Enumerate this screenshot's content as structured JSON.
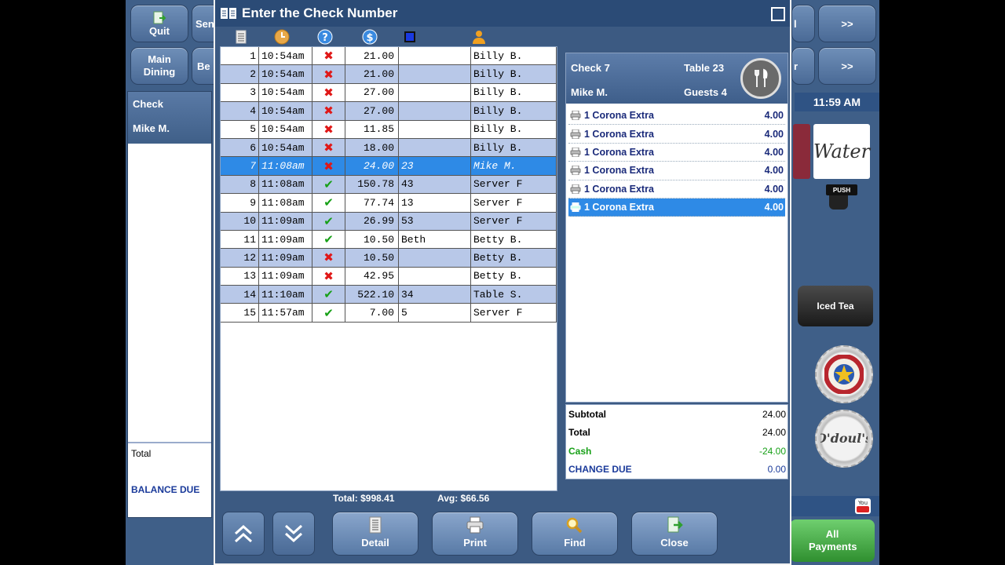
{
  "background": {
    "buttons": [
      {
        "label": "Quit"
      },
      {
        "label": "Sen"
      },
      {
        "label": "Main Dining"
      },
      {
        "label": "Be"
      },
      {
        "label": ">>"
      },
      {
        "label": ">>"
      },
      {
        "label": "l"
      },
      {
        "label": "r"
      }
    ],
    "left_panel": {
      "check_label": "Check",
      "server": "Mike M.",
      "total_label": "Total",
      "balance_label": "BALANCE DUE"
    },
    "clock": "11:59 AM",
    "water_label": "Water",
    "push_label": "PUSH",
    "iced_tea_label": "Iced Tea",
    "all_payments_label": "All Payments"
  },
  "dialog": {
    "title": "Enter the Check Number",
    "checks": [
      {
        "num": "1",
        "time": "10:54am",
        "paid": false,
        "amount": "21.00",
        "table": "",
        "server": "Billy B."
      },
      {
        "num": "2",
        "time": "10:54am",
        "paid": false,
        "amount": "21.00",
        "table": "",
        "server": "Billy B."
      },
      {
        "num": "3",
        "time": "10:54am",
        "paid": false,
        "amount": "27.00",
        "table": "",
        "server": "Billy B."
      },
      {
        "num": "4",
        "time": "10:54am",
        "paid": false,
        "amount": "27.00",
        "table": "",
        "server": "Billy B."
      },
      {
        "num": "5",
        "time": "10:54am",
        "paid": false,
        "amount": "11.85",
        "table": "",
        "server": "Billy B."
      },
      {
        "num": "6",
        "time": "10:54am",
        "paid": false,
        "amount": "18.00",
        "table": "",
        "server": "Billy B."
      },
      {
        "num": "7",
        "time": "11:08am",
        "paid": false,
        "amount": "24.00",
        "table": "23",
        "server": "Mike M.",
        "selected": true
      },
      {
        "num": "8",
        "time": "11:08am",
        "paid": true,
        "amount": "150.78",
        "table": "43",
        "server": "Server F"
      },
      {
        "num": "9",
        "time": "11:08am",
        "paid": true,
        "amount": "77.74",
        "table": "13",
        "server": "Server F"
      },
      {
        "num": "10",
        "time": "11:09am",
        "paid": true,
        "amount": "26.99",
        "table": "53",
        "server": "Server F"
      },
      {
        "num": "11",
        "time": "11:09am",
        "paid": true,
        "amount": "10.50",
        "table": "Beth",
        "server": "Betty B."
      },
      {
        "num": "12",
        "time": "11:09am",
        "paid": false,
        "amount": "10.50",
        "table": "",
        "server": "Betty B."
      },
      {
        "num": "13",
        "time": "11:09am",
        "paid": false,
        "amount": "42.95",
        "table": "",
        "server": "Betty B."
      },
      {
        "num": "14",
        "time": "11:10am",
        "paid": true,
        "amount": "522.10",
        "table": "34",
        "server": "Table S."
      },
      {
        "num": "15",
        "time": "11:57am",
        "paid": true,
        "amount": "7.00",
        "table": "5",
        "server": "Server F"
      }
    ],
    "summary": {
      "total_text": "Total:  $998.41",
      "avg_text": "Avg:  $66.56"
    },
    "check_detail": {
      "check": "Check 7",
      "table": "Table 23",
      "server": "Mike M.",
      "guests": "Guests 4",
      "items": [
        {
          "name": "1 Corona Extra",
          "price": "4.00"
        },
        {
          "name": "1 Corona Extra",
          "price": "4.00"
        },
        {
          "name": "1 Corona Extra",
          "price": "4.00"
        },
        {
          "name": "1 Corona Extra",
          "price": "4.00"
        },
        {
          "name": "1 Corona Extra",
          "price": "4.00"
        },
        {
          "name": "1 Corona Extra",
          "price": "4.00",
          "selected": true
        }
      ],
      "subtotal_label": "Subtotal",
      "subtotal": "24.00",
      "total_label": "Total",
      "total": "24.00",
      "cash_label": "Cash",
      "cash": "-24.00",
      "change_label": "CHANGE DUE",
      "change": "0.00"
    },
    "buttons": {
      "detail": "Detail",
      "print": "Print",
      "find": "Find",
      "close": "Close"
    }
  },
  "colors": {
    "selection": "#2e8ae6",
    "alt_row": "#b8c8e8",
    "cash_green": "#17a017",
    "unpaid_red": "#e01818"
  }
}
